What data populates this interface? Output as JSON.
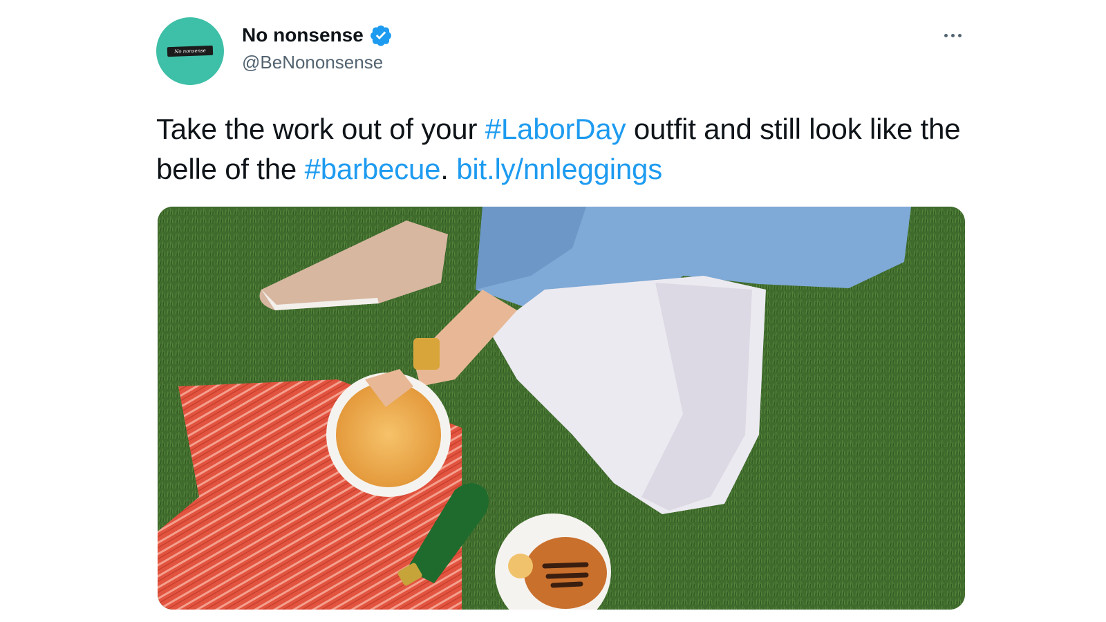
{
  "account": {
    "display_name": "No nonsense",
    "handle": "@BeNononsense",
    "verified": true,
    "avatar_logo_text": "No nonsense"
  },
  "icons": {
    "verified": "verified-badge-icon",
    "more": "more-options-icon"
  },
  "tweet": {
    "segments": [
      {
        "text": "Take the work out of your ",
        "type": "text"
      },
      {
        "text": "#LaborDay",
        "type": "hashtag"
      },
      {
        "text": " outfit and still look like the belle of the ",
        "type": "text"
      },
      {
        "text": "#barbecue",
        "type": "hashtag"
      },
      {
        "text": ". ",
        "type": "text"
      },
      {
        "text": "bit.ly/nnleggings",
        "type": "url"
      }
    ]
  },
  "media": {
    "kind": "photo",
    "subject": "picnic on grass: white leggings, blue shirt, chips bowl, burger, green bottle, red striped blanket"
  },
  "colors": {
    "link": "#1d9bf0",
    "text": "#0f1419",
    "secondary_text": "#536471",
    "avatar_bg": "#3ebfa7",
    "verified": "#1d9bf0"
  }
}
